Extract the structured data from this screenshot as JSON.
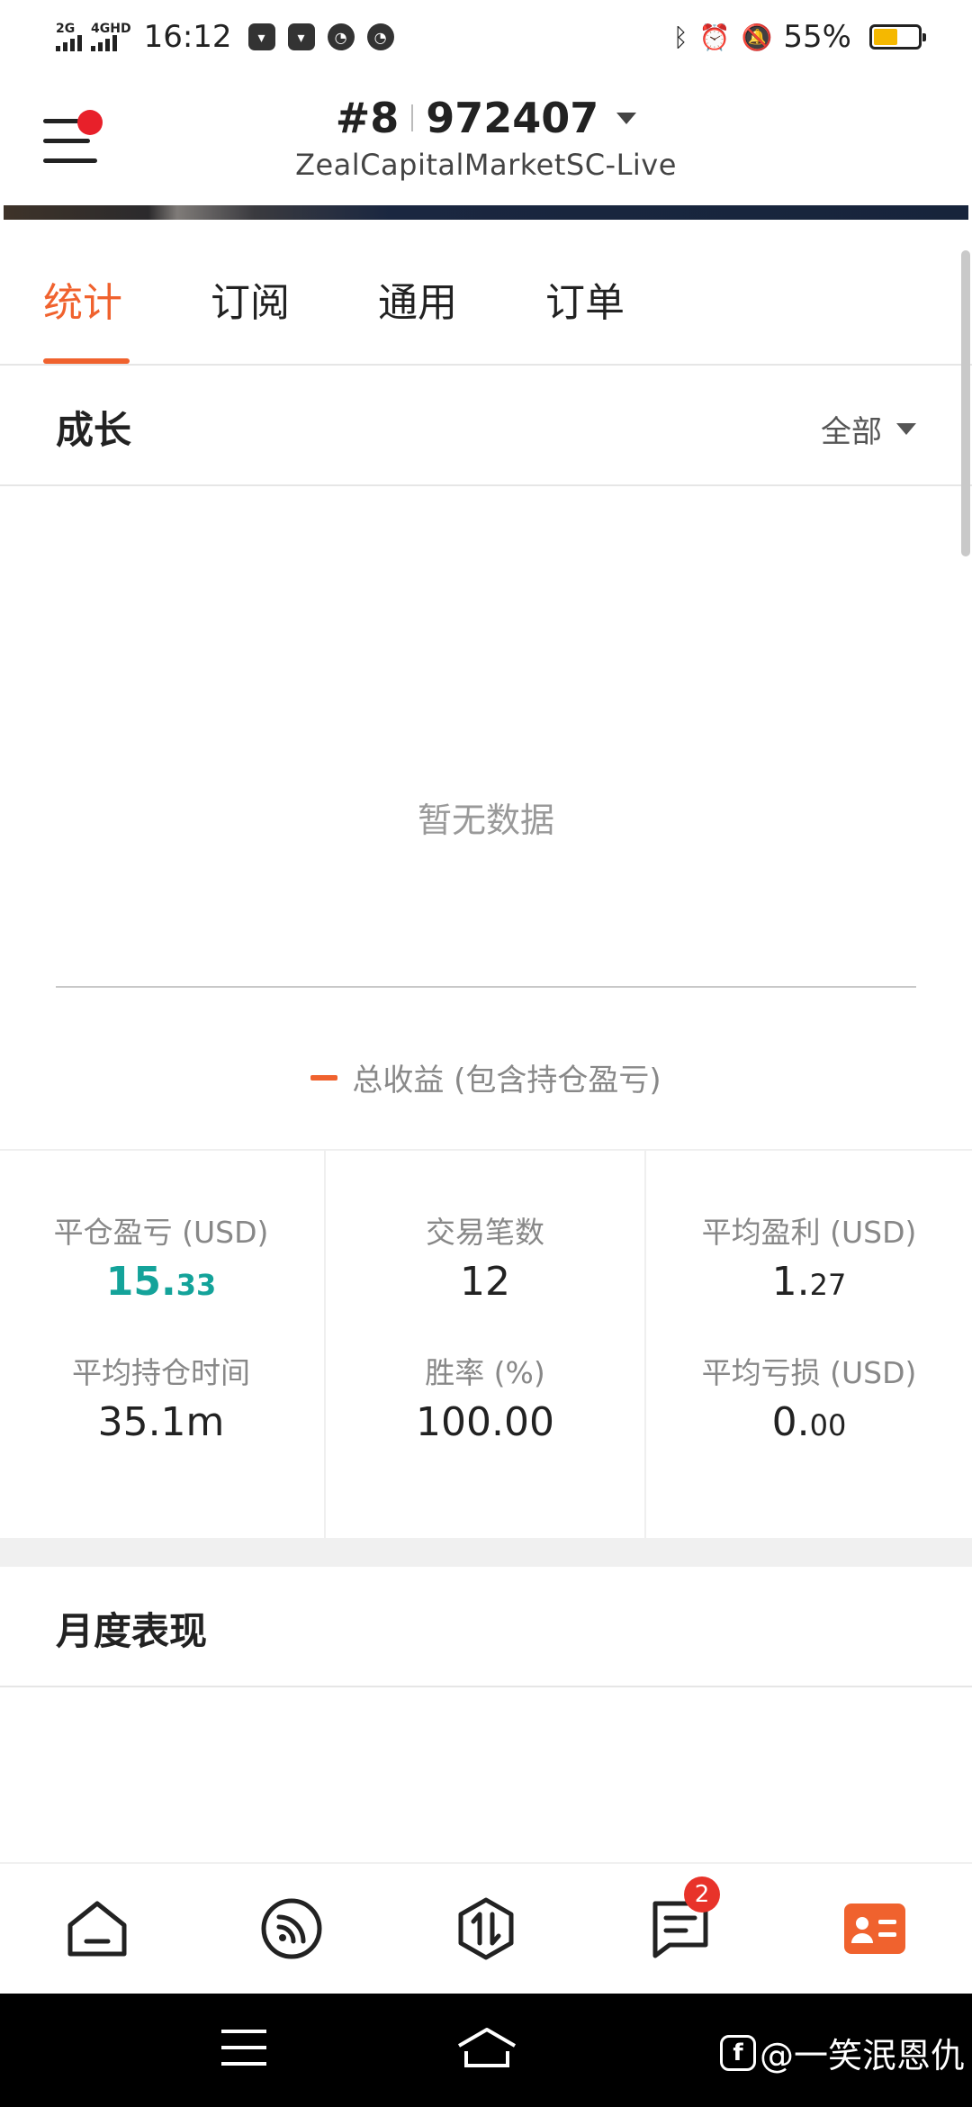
{
  "status_bar": {
    "network1": "2G",
    "network2": "4GHD",
    "time": "16:12",
    "battery_percent": "55%",
    "battery_level": 0.55
  },
  "header": {
    "account_prefix": "#8",
    "account_number": "972407",
    "server": "ZealCapitalMarketSC-Live"
  },
  "tabs": [
    {
      "label": "统计",
      "active": true
    },
    {
      "label": "订阅",
      "active": false
    },
    {
      "label": "通用",
      "active": false
    },
    {
      "label": "订单",
      "active": false
    }
  ],
  "growth": {
    "title": "成长",
    "filter_label": "全部",
    "empty_text": "暂无数据",
    "legend_label": "总收益 (包含持仓盈亏)"
  },
  "stats": {
    "closed_pnl_label": "平仓盈亏 (USD)",
    "closed_pnl_int": "15.",
    "closed_pnl_dec": "33",
    "trades_label": "交易笔数",
    "trades_value": "12",
    "avg_profit_label": "平均盈利 (USD)",
    "avg_profit_int": "1.",
    "avg_profit_dec": "27",
    "avg_hold_label": "平均持仓时间",
    "avg_hold_value": "35.1m",
    "win_rate_label": "胜率 (%)",
    "win_rate_value": "100.00",
    "avg_loss_label": "平均亏损 (USD)",
    "avg_loss_int": "0.",
    "avg_loss_dec": "00"
  },
  "monthly": {
    "title": "月度表现"
  },
  "bottom_nav": {
    "items": [
      "home-icon",
      "feed-icon",
      "trade-icon",
      "messages-icon",
      "profile-card-icon"
    ],
    "messages_badge": "2",
    "active_color": "#f0622e"
  },
  "watermark": {
    "text": "@一笑泯恩仇"
  },
  "colors": {
    "accent": "#f0622e",
    "positive": "#14a39a"
  }
}
